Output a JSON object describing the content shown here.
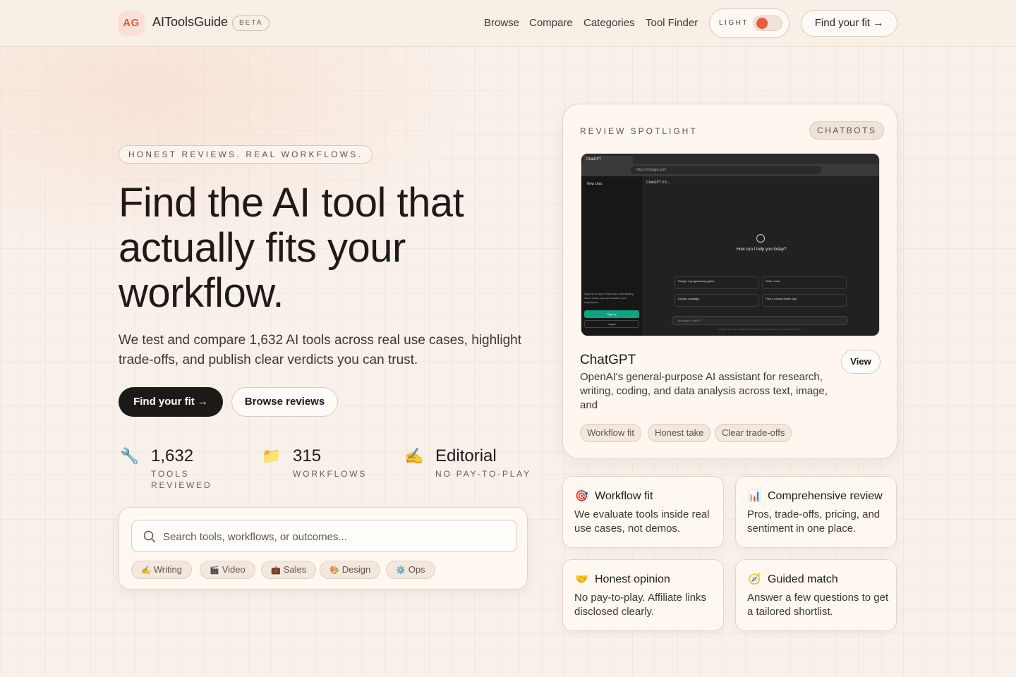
{
  "header": {
    "logo_initials": "AG",
    "brand": "AIToolsGuide",
    "badge": "BETA",
    "nav": [
      "Browse",
      "Compare",
      "Categories",
      "Tool Finder"
    ],
    "theme_label": "LIGHT",
    "cta": "Find your fit →"
  },
  "hero": {
    "eyebrow": "HONEST REVIEWS. REAL WORKFLOWS.",
    "title": "Find the AI tool that actually fits your workflow.",
    "subtitle": "We test and compare 1,632 AI tools across real use cases, highlight trade-offs, and publish clear verdicts you can trust.",
    "primary_cta": "Find your fit →",
    "secondary_cta": "Browse reviews",
    "stats": [
      {
        "icon": "🔧",
        "value": "1,632",
        "label": "TOOLS REVIEWED"
      },
      {
        "icon": "📁",
        "value": "315",
        "label": "WORKFLOWS"
      },
      {
        "icon": "✍️",
        "value": "Editorial",
        "label": "NO PAY-TO-PLAY"
      }
    ]
  },
  "search": {
    "placeholder": "Search tools, workflows, or outcomes...",
    "chips": [
      {
        "icon": "✍️",
        "label": "Writing"
      },
      {
        "icon": "🎬",
        "label": "Video"
      },
      {
        "icon": "💼",
        "label": "Sales"
      },
      {
        "icon": "🎨",
        "label": "Design"
      },
      {
        "icon": "⚙️",
        "label": "Ops"
      }
    ]
  },
  "spotlight": {
    "eyebrow": "REVIEW SPOTLIGHT",
    "category": "CHATBOTS",
    "screenshot": {
      "tab": "ChatGPT",
      "url": "https://chatgpt.com",
      "new_chat": "New chat",
      "model": "ChatGPT 3.5 ⌄",
      "prompt": "How can I help you today?",
      "signup_text": "Sign up or log in  Save your chat history, share chats, and personalize your experience.",
      "signup": "Sign up",
      "login": "Log in",
      "suggestions": [
        "Design a programming game",
        "Write a text",
        "Explain nostalgia",
        "Plan a mental health day"
      ],
      "message_placeholder": "Message ChatGPT",
      "footer": "ChatGPT can make mistakes. Check important info. Read our Terms and Privacy Policy."
    },
    "tool_name": "ChatGPT",
    "description": "OpenAI's general-purpose AI assistant for research, writing, coding, and data analysis across text, image, and",
    "view": "View",
    "tags": [
      "Workflow fit",
      "Honest take",
      "Clear trade-offs"
    ]
  },
  "features": [
    {
      "icon": "🎯",
      "title": "Workflow fit",
      "desc": "We evaluate tools inside real use cases, not demos."
    },
    {
      "icon": "📊",
      "title": "Comprehensive review",
      "desc": "Pros, trade-offs, pricing, and sentiment in one place."
    },
    {
      "icon": "🤝",
      "title": "Honest opinion",
      "desc": "No pay-to-play. Affiliate links disclosed clearly."
    },
    {
      "icon": "🧭",
      "title": "Guided match",
      "desc": "Answer a few questions to get a tailored shortlist."
    }
  ],
  "colors": {
    "accent": "#e85c3c",
    "background": "#f8f1ea",
    "dark": "#1d1916"
  }
}
